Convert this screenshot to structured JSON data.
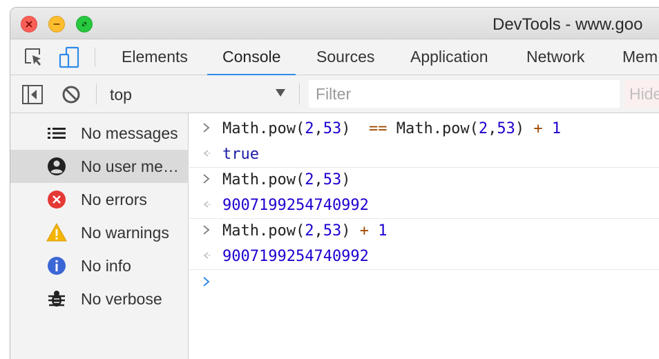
{
  "window": {
    "title": "DevTools - www.goo"
  },
  "tabs": [
    {
      "label": "Elements"
    },
    {
      "label": "Console"
    },
    {
      "label": "Sources"
    },
    {
      "label": "Application"
    },
    {
      "label": "Network"
    },
    {
      "label": "Mem"
    }
  ],
  "active_tab": "Console",
  "toolbar": {
    "context": "top",
    "filter_placeholder": "Filter",
    "hide_network_label": "Hide"
  },
  "sidebar": {
    "items": [
      {
        "label": "No messages",
        "icon": "list-icon"
      },
      {
        "label": "No user me…",
        "icon": "user-icon"
      },
      {
        "label": "No errors",
        "icon": "error-icon"
      },
      {
        "label": "No warnings",
        "icon": "warning-icon"
      },
      {
        "label": "No info",
        "icon": "info-icon"
      },
      {
        "label": "No verbose",
        "icon": "bug-icon"
      }
    ],
    "selected_index": 1
  },
  "console": {
    "entries": [
      {
        "input": {
          "p1": "Math.pow(",
          "n1": "2",
          "p2": ",",
          "n2": "53",
          "p3": ")  ",
          "op1": "==",
          "p4": " Math.pow(",
          "n3": "2",
          "p5": ",",
          "n4": "53",
          "p6": ") ",
          "op2": "+",
          "p7": " ",
          "n5": "1"
        },
        "output": "true"
      },
      {
        "input": {
          "p1": "Math.pow(",
          "n1": "2",
          "p2": ",",
          "n2": "53",
          "p3": ")"
        },
        "output": "9007199254740992"
      },
      {
        "input": {
          "p1": "Math.pow(",
          "n1": "2",
          "p2": ",",
          "n2": "53",
          "p3": ") ",
          "op1": "+",
          "p4": " ",
          "n3": "1"
        },
        "output": "9007199254740992"
      }
    ]
  },
  "colors": {
    "accent": "#2f89e8",
    "error": "#e53935",
    "warning": "#f5b400",
    "info": "#3b66d6",
    "number": "#1c00cf"
  }
}
